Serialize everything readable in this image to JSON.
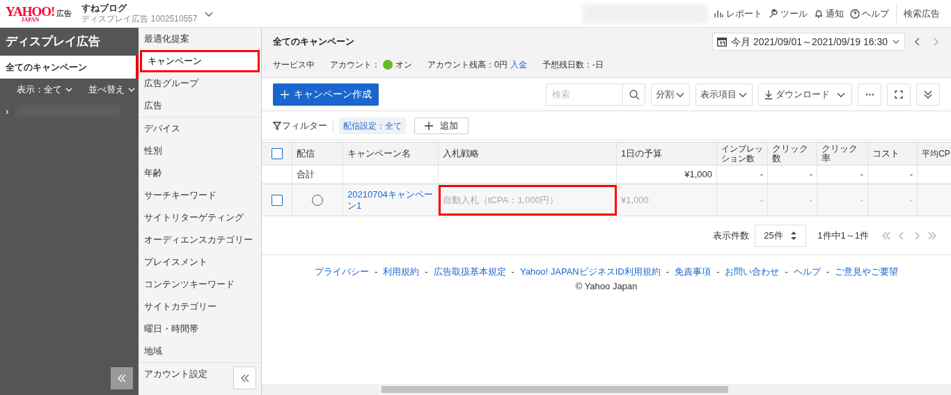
{
  "header": {
    "logo": "YAHOO!",
    "logo_sub": "JAPAN",
    "logo_suffix": "広告",
    "account_name": "すねブログ",
    "account_detail": "ディスプレイ広告 1002510557",
    "links": [
      {
        "kind": "report",
        "label": "レポート"
      },
      {
        "kind": "tool",
        "label": "ツール"
      },
      {
        "kind": "bell",
        "label": "通知"
      },
      {
        "kind": "help",
        "label": "ヘルプ"
      }
    ],
    "switch_link": "検索広告"
  },
  "sidebar": {
    "title": "ディスプレイ広告",
    "all_campaigns": {
      "label": "全てのキャンペーン",
      "selected": true
    },
    "filter": "表示：全て",
    "sort": "並べ替え",
    "tree_arrow": "›"
  },
  "nav": {
    "groups": [
      [
        {
          "label": "最適化提案",
          "selected": false,
          "highlighted": false
        },
        {
          "label": "キャンペーン",
          "selected": true,
          "highlighted": true
        },
        {
          "label": "広告グループ",
          "selected": false,
          "highlighted": false
        },
        {
          "label": "広告",
          "selected": false,
          "highlighted": false
        }
      ],
      [
        {
          "label": "デバイス",
          "selected": false,
          "highlighted": false
        },
        {
          "label": "性別",
          "selected": false,
          "highlighted": false
        },
        {
          "label": "年齢",
          "selected": false,
          "highlighted": false
        },
        {
          "label": "サーチキーワード",
          "selected": false,
          "highlighted": false
        },
        {
          "label": "サイトリターゲティング",
          "selected": false,
          "highlighted": false
        },
        {
          "label": "オーディエンスカテゴリー",
          "selected": false,
          "highlighted": false
        },
        {
          "label": "プレイスメント",
          "selected": false,
          "highlighted": false
        },
        {
          "label": "コンテンツキーワード",
          "selected": false,
          "highlighted": false
        },
        {
          "label": "サイトカテゴリー",
          "selected": false,
          "highlighted": false
        },
        {
          "label": "曜日・時間帯",
          "selected": false,
          "highlighted": false
        },
        {
          "label": "地域",
          "selected": false,
          "highlighted": false
        }
      ],
      [
        {
          "label": "アカウント設定",
          "selected": false,
          "highlighted": false
        }
      ]
    ]
  },
  "main": {
    "title": "全てのキャンペーン",
    "date_range": "今月 2021/09/01～2021/09/19 16:30",
    "status": {
      "service": "サービス中",
      "account_label": "アカウント：",
      "account_on": true,
      "account_state": "オン",
      "balance": "アカウント残高：0円",
      "deposit_link": "入金",
      "days": "予想残日数：-日"
    },
    "create_button": "キャンペーン作成",
    "search": {
      "placeholder": "検索"
    },
    "tools": [
      {
        "kind": "dropdown",
        "label": "分割"
      },
      {
        "kind": "dropdown",
        "label": "表示項目"
      },
      {
        "kind": "download",
        "label": "ダウンロード"
      },
      {
        "kind": "more",
        "label": "⋯"
      },
      {
        "kind": "expand"
      },
      {
        "kind": "collapse"
      }
    ],
    "filter": {
      "label": "フィルター",
      "chip": "配信設定：全て",
      "add": "追加"
    },
    "table": {
      "select_all_checked": false,
      "columns": [
        "",
        "配信",
        "キャンペーン名",
        "入札戦略",
        "1日の予算",
        "インプレッション数",
        "クリック数",
        "クリック率",
        "コスト",
        "平均CP"
      ],
      "rows": [
        {
          "kind": "total",
          "cells": [
            "",
            "合計",
            "",
            "",
            "¥1,000",
            "-",
            "-",
            "-",
            "-",
            ""
          ]
        },
        {
          "kind": "campaign",
          "checked": false,
          "cells": [
            "",
            "",
            "20210704キャンペーン1",
            "自動入札（tCPA：1,000円）",
            "¥1,000",
            "-",
            "-",
            "-",
            "-",
            ""
          ],
          "highlighted": [
            false,
            false,
            false,
            true,
            false,
            false,
            false,
            false,
            false,
            false
          ]
        }
      ]
    },
    "pagination": {
      "label": "表示件数",
      "per_page": "25件",
      "summary": "1件中1～1件"
    },
    "footer": {
      "links": [
        "プライバシー",
        "利用規約",
        "広告取扱基本規定",
        "Yahoo! JAPANビジネスID利用規約",
        "免責事項",
        "お問い合わせ",
        "ヘルプ",
        "ご意見やご要望"
      ],
      "separator": "-",
      "copyright": "© Yahoo Japan"
    }
  }
}
